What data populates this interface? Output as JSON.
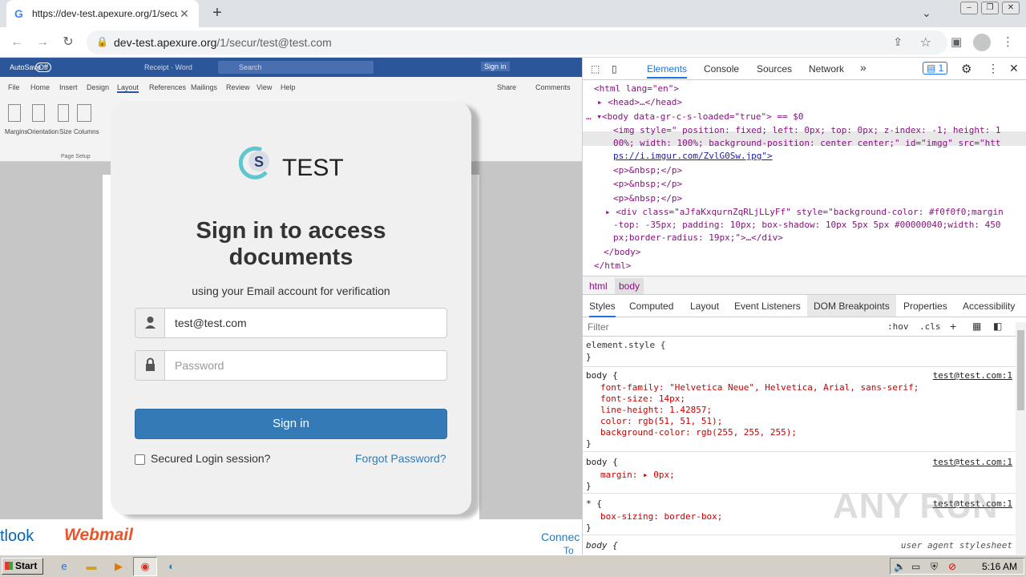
{
  "browser": {
    "tab_title": "https://dev-test.apexure.org/1/secur",
    "url_host": "dev-test.apexure.org",
    "url_path": "/1/secur/test@test.com"
  },
  "word": {
    "autosave": "AutoSave",
    "autosave_state": "Off",
    "doc_title": "Receipt · Word",
    "search": "Search",
    "signin": "Sign in",
    "share": "Share",
    "comments": "Comments",
    "ribbon_tabs": [
      "File",
      "Home",
      "Insert",
      "Design",
      "Layout",
      "References",
      "Mailings",
      "Review",
      "View",
      "Help"
    ],
    "ribbon_buttons": [
      "Margins",
      "Orientation",
      "Size",
      "Columns"
    ],
    "group_label": "Page Setup",
    "bottom_left": "tlook",
    "bottom_webmail": "Webmail",
    "bottom_right1": "Connec",
    "bottom_right2": "To"
  },
  "login": {
    "logo_letter": "S",
    "logo_text": "TEST",
    "heading_line1": "Sign in to access",
    "heading_line2": "documents",
    "subheading": "using your Email account for verification",
    "email_value": "test@test.com",
    "password_placeholder": "Password",
    "signin_button": "Sign in",
    "remember_label": "Secured Login session?",
    "forgot_link": "Forgot Password?"
  },
  "devtools": {
    "tabs": [
      "Elements",
      "Console",
      "Sources",
      "Network"
    ],
    "more": "»",
    "issues_count": "1",
    "crumbs": [
      "html",
      "body"
    ],
    "subtabs": [
      "Styles",
      "Computed",
      "Layout",
      "Event Listeners",
      "DOM Breakpoints",
      "Properties",
      "Accessibility"
    ],
    "filter_placeholder": "Filter",
    "hov": ":hov",
    "cls": ".cls",
    "dom": {
      "l1": "<html lang=\"en\">",
      "l2": "<head>…</head>",
      "l3": "<body data-gr-c-s-loaded=\"true\"> == $0",
      "l4": "<img style=\" position: fixed; left: 0px; top: 0px; z-index: -1; height: 1",
      "l5": "00%; width: 100%; background-position: center center;\" id=\"imgg\" src=\"htt",
      "l6": "ps://i.imgur.com/ZvlG0Sw.jpg\">",
      "l7": "<p>&nbsp;</p>",
      "l8": "<p>&nbsp;</p>",
      "l9": "<p>&nbsp;</p>",
      "l10": "<div class=\"aJfaKxqurnZqRLjLLyFf\" style=\"background-color: #f0f0f0;margin",
      "l11": "-top: -35px; padding: 10px; box-shadow: 10px 5px 5px #00000040;width: 450",
      "l12": "px;border-radius: 19px;\">…</div>",
      "l13": "</body>",
      "l14": "</html>"
    },
    "styles": {
      "element_style": "element.style {",
      "close": "}",
      "rule1_selector": "body {",
      "rule1_source": "test@test.com:1",
      "rule1_props": [
        "font-family: \"Helvetica Neue\", Helvetica, Arial, sans-serif;",
        "font-size: 14px;",
        "line-height: 1.42857;",
        "color: rgb(51, 51, 51);",
        "background-color: rgb(255, 255, 255);"
      ],
      "rule2_selector": "body {",
      "rule2_source": "test@test.com:1",
      "rule2_prop": "margin: ▸ 0px;",
      "rule3_selector": "* {",
      "rule3_source": "test@test.com:1",
      "rule3_prop": "box-sizing: border-box;",
      "rule4_selector": "body {",
      "rule4_source": "user agent stylesheet"
    }
  },
  "watermark": "ANY RUN",
  "taskbar": {
    "start": "Start",
    "clock": "5:16 AM"
  }
}
